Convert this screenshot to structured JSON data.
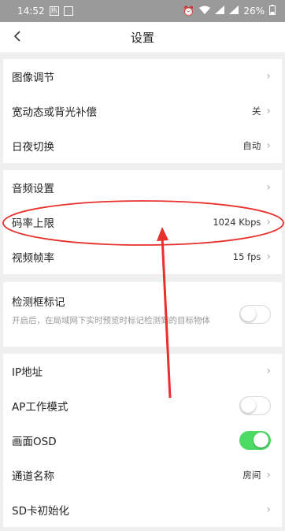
{
  "status_bar": {
    "time": "14:52",
    "icon1": "热",
    "battery": "26%"
  },
  "header": {
    "back_icon": "‹",
    "title": "设置"
  },
  "section1": [
    {
      "label": "图像调节",
      "value": ""
    },
    {
      "label": "宽动态或背光补偿",
      "value": "关"
    },
    {
      "label": "日夜切换",
      "value": "自动"
    }
  ],
  "section2": [
    {
      "label": "音频设置",
      "value": ""
    },
    {
      "label": "码率上限",
      "value": "1024 Kbps"
    },
    {
      "label": "视频帧率",
      "value": "15 fps"
    }
  ],
  "detection": {
    "label": "检测框标记",
    "description": "开启后，在局域网下实时预览时标记检测到的目标物体",
    "enabled": false
  },
  "section4": [
    {
      "label": "IP地址",
      "value": ""
    },
    {
      "label": "AP工作模式",
      "value": ""
    },
    {
      "label": "画面OSD",
      "value": ""
    },
    {
      "label": "通道名称",
      "value": "房间"
    },
    {
      "label": "SD卡初始化",
      "value": ""
    }
  ],
  "toggles": {
    "ap_mode": false,
    "osd": true
  },
  "colors": {
    "toggle_on": "#4cd964",
    "annotation_red": "#e8302c",
    "background": "#efefef"
  }
}
